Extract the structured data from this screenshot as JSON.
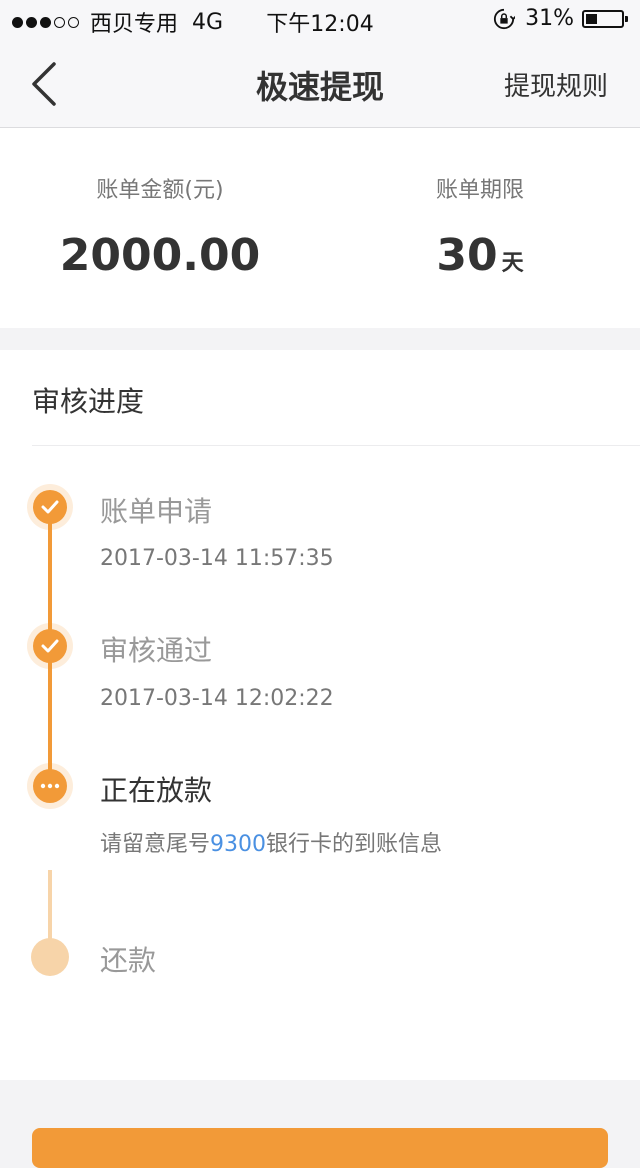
{
  "status_bar": {
    "carrier": "西贝专用",
    "network": "4G",
    "time": "下午12:04",
    "battery_percent": "31%",
    "battery_level": 0.31,
    "icons": [
      "signal-dots",
      "rotation-lock-icon",
      "battery-icon"
    ]
  },
  "nav": {
    "title": "极速提现",
    "right_action": "提现规则",
    "back_icon": "chevron-left-icon"
  },
  "summary": {
    "amount_label": "账单金额(元)",
    "amount_value": "2000.00",
    "term_label": "账单期限",
    "term_value": "30",
    "term_unit": "天"
  },
  "progress": {
    "title": "审核进度",
    "steps": [
      {
        "title": "账单申请",
        "time": "2017-03-14 11:57:35",
        "status": "done"
      },
      {
        "title": "审核通过",
        "time": "2017-03-14 12:02:22",
        "status": "done"
      },
      {
        "title": "正在放款",
        "note_prefix": "请留意尾号",
        "note_card": "9300",
        "note_suffix": "银行卡的到账信息",
        "status": "active"
      },
      {
        "title": "还款",
        "status": "pending"
      }
    ]
  },
  "colors": {
    "accent": "#f29a38",
    "accent_light": "#f7d4a9",
    "link": "#4a90e2"
  }
}
